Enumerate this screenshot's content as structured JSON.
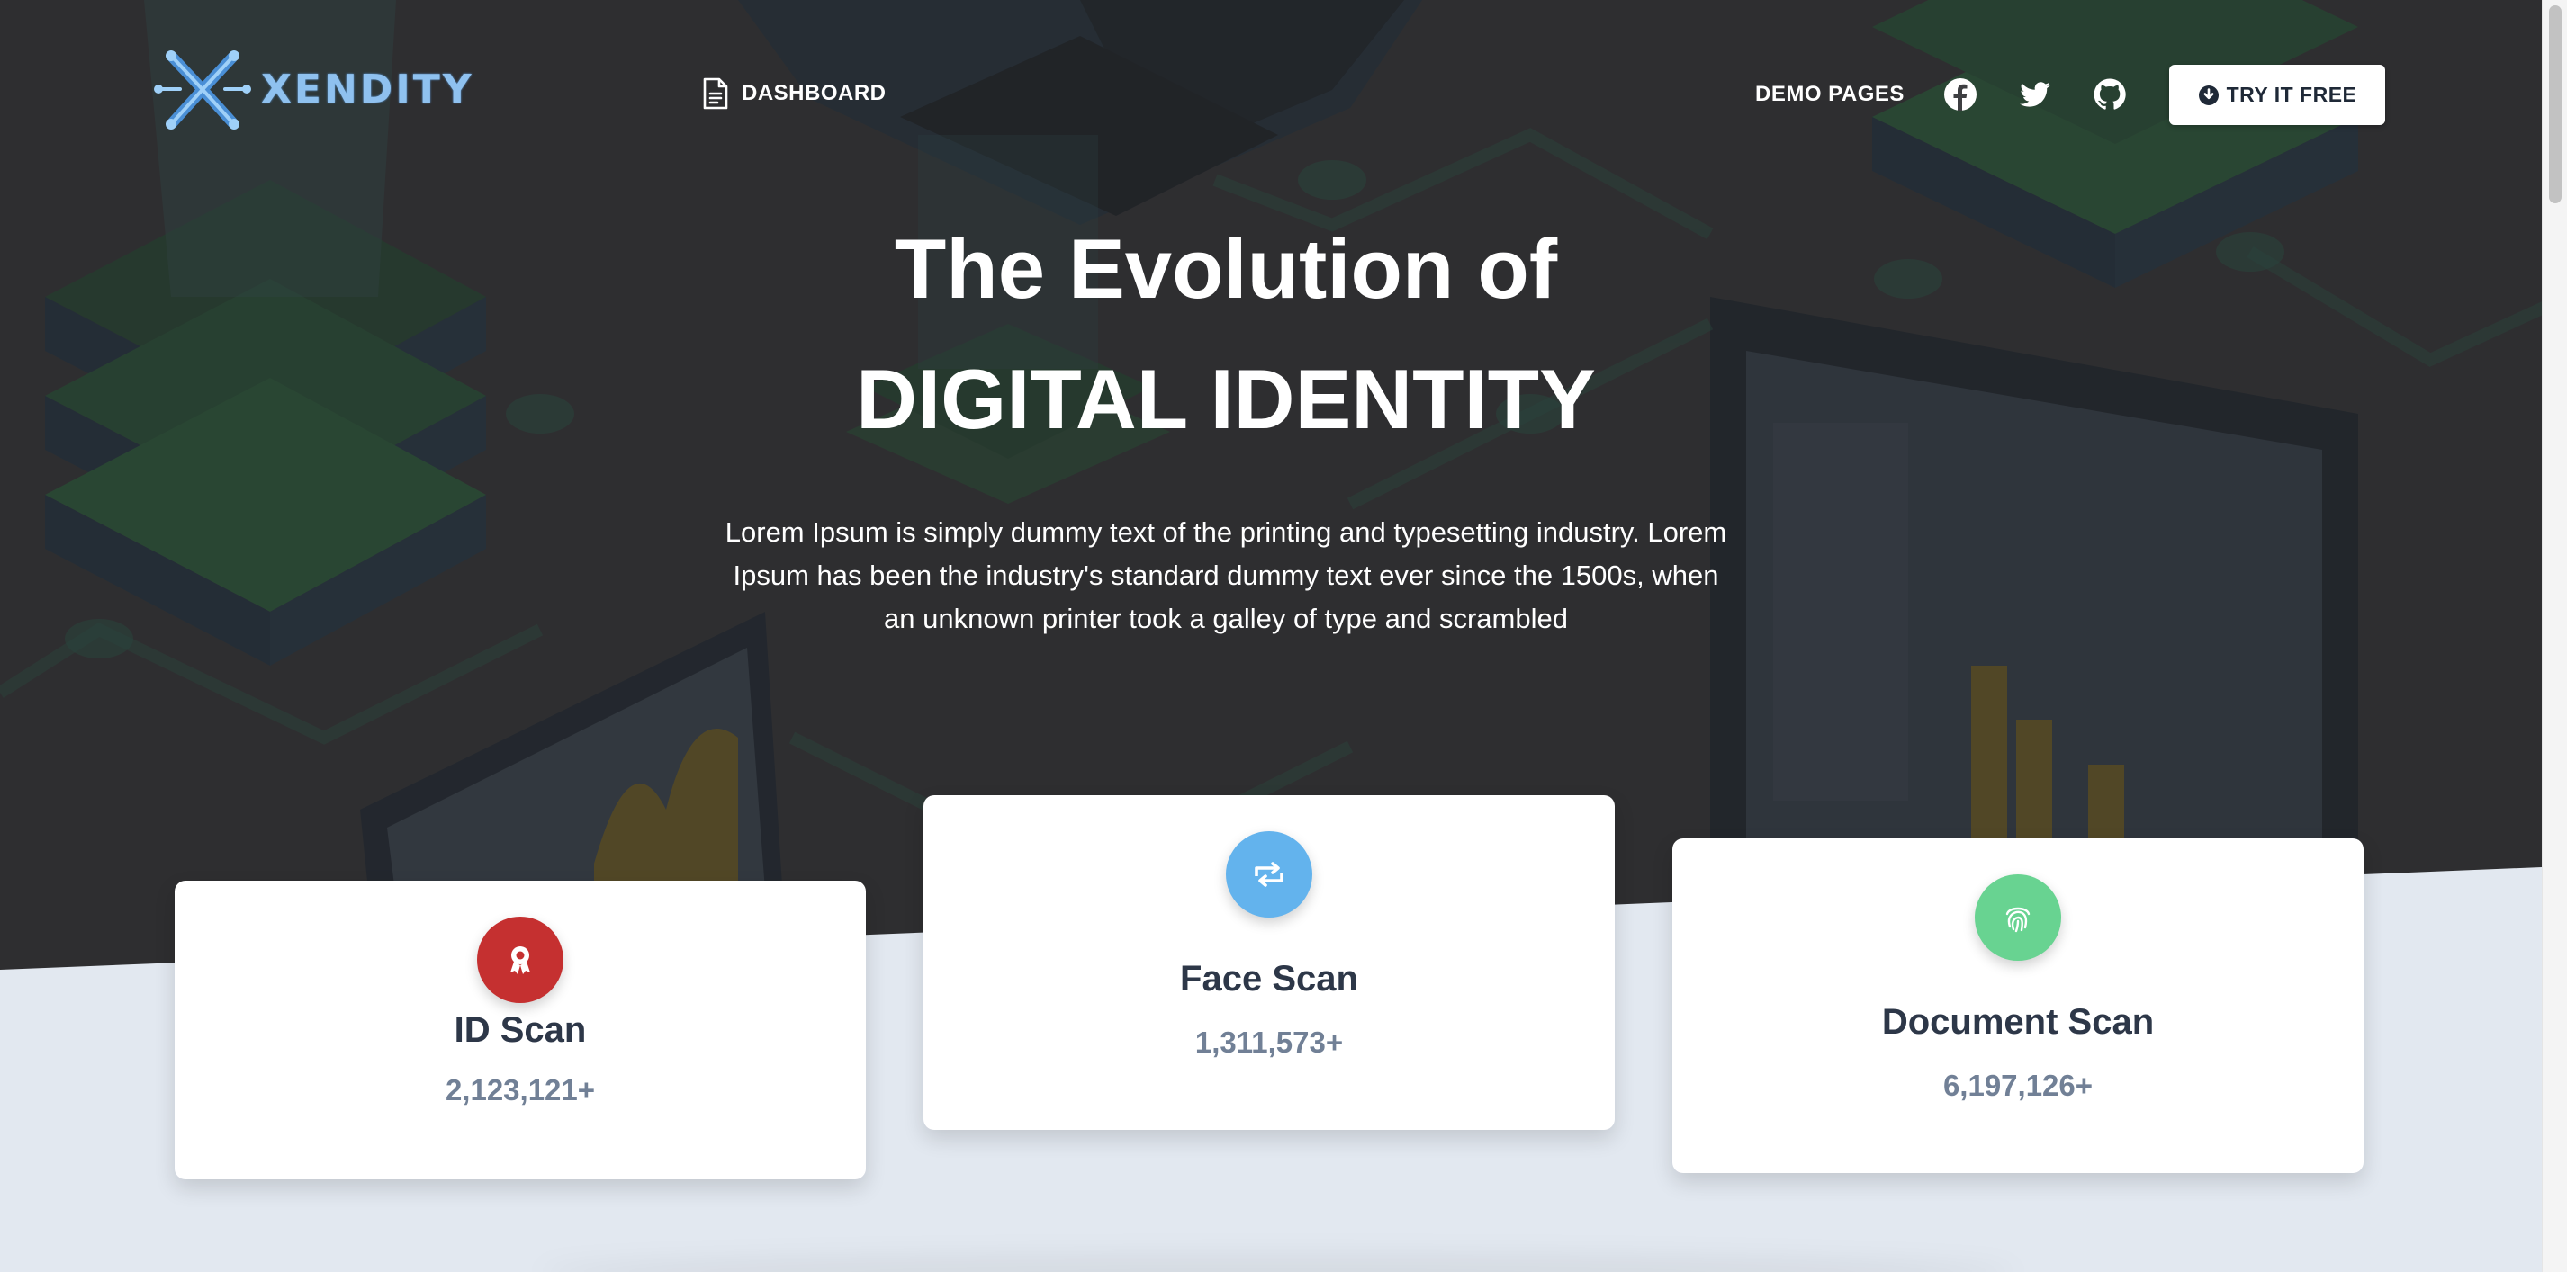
{
  "brand": {
    "name": "XENDITY",
    "logo_icon": "x-logo-icon",
    "logo_color": "#8fc1ef"
  },
  "nav": {
    "dashboard_label": "DASHBOARD",
    "dashboard_icon": "document-icon",
    "demo_label": "DEMO PAGES",
    "social": [
      "facebook-icon",
      "twitter-icon",
      "github-icon"
    ],
    "cta_label": "TRY IT FREE",
    "cta_icon": "download-circle-icon"
  },
  "hero": {
    "title_line1": "The Evolution of",
    "title_line2": "DIGITAL IDENTITY",
    "description": "Lorem Ipsum is simply dummy text of the printing and typesetting industry. Lorem Ipsum has been the industry's standard dummy text ever since the 1500s, when an unknown printer took a galley of type and scrambled"
  },
  "stats": [
    {
      "title": "ID Scan",
      "value": "2,123,121+",
      "icon": "award-icon",
      "color": "#c53030"
    },
    {
      "title": "Face Scan",
      "value": "1,311,573+",
      "icon": "retweet-icon",
      "color": "#63b3ed"
    },
    {
      "title": "Document Scan",
      "value": "6,197,126+",
      "icon": "fingerprint-icon",
      "color": "#68d391"
    }
  ],
  "colors": {
    "page_bg": "#e2e8f0",
    "hero_bg": "#3e3f42",
    "card_title": "#2d3748",
    "card_value": "#718096"
  }
}
